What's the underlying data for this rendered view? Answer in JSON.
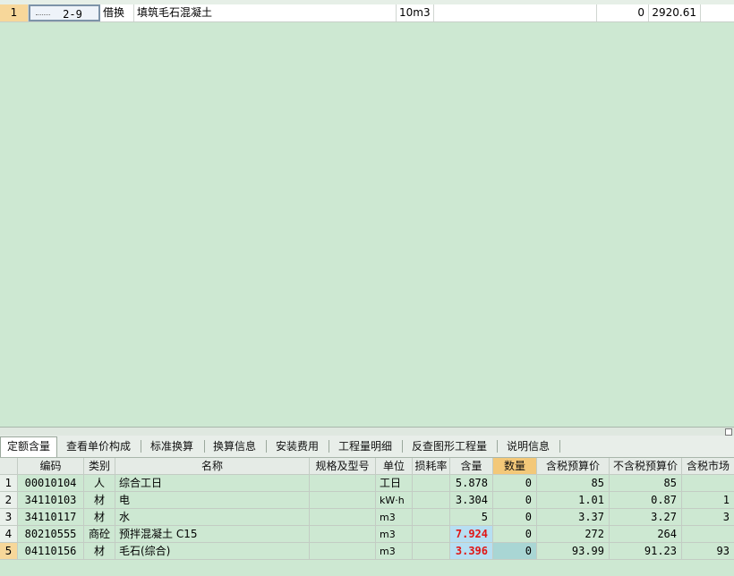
{
  "top_grid": {
    "row": {
      "number": "1",
      "code": "2-9",
      "type": "借换",
      "name": "填筑毛石混凝土",
      "unit": "10m3",
      "spec": "",
      "quantity": "0",
      "price": "2920.61"
    }
  },
  "tabs": [
    {
      "label": "定额含量",
      "active": true
    },
    {
      "label": "查看单价构成",
      "active": false
    },
    {
      "label": "标准换算",
      "active": false
    },
    {
      "label": "换算信息",
      "active": false
    },
    {
      "label": "安装费用",
      "active": false
    },
    {
      "label": "工程量明细",
      "active": false
    },
    {
      "label": "反查图形工程量",
      "active": false
    },
    {
      "label": "说明信息",
      "active": false
    }
  ],
  "columns": {
    "code": "编码",
    "category": "类别",
    "name": "名称",
    "spec": "规格及型号",
    "unit": "单位",
    "loss": "损耗率",
    "content": "含量",
    "quantity": "数量",
    "tax_budget": "含税预算价",
    "notax_budget": "不含税预算价",
    "tax_market": "含税市场"
  },
  "rows": [
    {
      "num": "1",
      "code": "00010104",
      "category": "人",
      "name": "综合工日",
      "spec": "",
      "unit": "工日",
      "loss": "",
      "content": "5.878",
      "quantity": "0",
      "tax_budget": "85",
      "notax_budget": "85",
      "tax_market": ""
    },
    {
      "num": "2",
      "code": "34110103",
      "category": "材",
      "name": "电",
      "spec": "",
      "unit": "kW·h",
      "loss": "",
      "content": "3.304",
      "quantity": "0",
      "tax_budget": "1.01",
      "notax_budget": "0.87",
      "tax_market": "1"
    },
    {
      "num": "3",
      "code": "34110117",
      "category": "材",
      "name": "水",
      "spec": "",
      "unit": "m3",
      "loss": "",
      "content": "5",
      "quantity": "0",
      "tax_budget": "3.37",
      "notax_budget": "3.27",
      "tax_market": "3"
    },
    {
      "num": "4",
      "code": "80210555",
      "category": "商砼",
      "name": "预拌混凝土 C15",
      "spec": "",
      "unit": "m3",
      "loss": "",
      "content": "7.924",
      "quantity": "0",
      "tax_budget": "272",
      "notax_budget": "264",
      "tax_market": ""
    },
    {
      "num": "5",
      "code": "04110156",
      "category": "材",
      "name": "毛石(综合)",
      "spec": "",
      "unit": "m3",
      "loss": "",
      "content": "3.396",
      "quantity": "0",
      "tax_budget": "93.99",
      "notax_budget": "91.23",
      "tax_market": "93"
    }
  ]
}
